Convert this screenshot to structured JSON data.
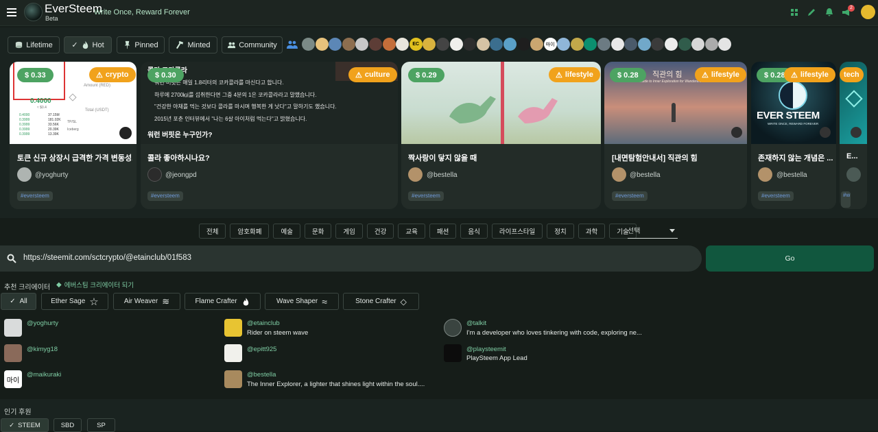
{
  "header": {
    "brand": "EverSteem",
    "tagline": "Write Once, Reward Forever",
    "beta": "Beta",
    "notifications": "2"
  },
  "tabs": [
    {
      "label": "Lifetime",
      "icon": "coins-icon"
    },
    {
      "label": "Hot",
      "icon": "fire-icon",
      "active": true
    },
    {
      "label": "Pinned",
      "icon": "pin-icon"
    },
    {
      "label": "Minted",
      "icon": "hammer-icon"
    },
    {
      "label": "Community",
      "icon": "group-icon"
    }
  ],
  "avatar_labels": [
    "EC",
    "마이"
  ],
  "cards": [
    {
      "price": "$ 0.33",
      "category": "crypto",
      "title": "토큰 신규 상장시 급격한 가격 변동성...",
      "user": "@yoghurty",
      "tag": "#eversteem"
    },
    {
      "price": "$ 0.30",
      "category": "culture",
      "title": "콜라 좋아하시나요?",
      "user": "@jeongpd",
      "tag": "#eversteem"
    },
    {
      "price": "$ 0.29",
      "category": "lifestyle",
      "title": "짝사랑이 닿지 않을 때",
      "user": "@bestella",
      "tag": "#eversteem"
    },
    {
      "price": "$ 0.28",
      "category": "lifestyle",
      "title": "[내면탐험안내서] 직관의 힘",
      "user": "@bestella",
      "tag": "#eversteem"
    },
    {
      "price": "$ 0.28",
      "category": "lifestyle",
      "title": "존재하지 않는 개념은 ...",
      "user": "@bestella",
      "tag": "#eversteem"
    },
    {
      "price": "",
      "category": "tech",
      "title": "E...",
      "user": "",
      "tag": "#w"
    }
  ],
  "thumb_text": {
    "crypto_amount": "0.4000",
    "crypto_sub": "≈ $0.4",
    "crypto_label_red": "Amount (RED)",
    "crypto_total": "Total (USDT)",
    "crypto_tpsl": "TP/SL",
    "crypto_iceberg": "Iceberg",
    "crypto_prices": [
      "0.4000",
      "0.3999",
      "0.3999",
      "0.3999",
      "0.3999"
    ],
    "crypto_vols": [
      "37.15M",
      "181.02K",
      "33.56K",
      "20.39K",
      "13.39K"
    ],
    "culture_heading": "콜라 코카콜라",
    "culture_lines": [
      "워런 버핏은 매일 1.8리터의 코카콜라를 마신다고 합니다.",
      "하루에 2700㎉를 섭취한다면 그중 4분의 1은 코카콜라라고 말했습니다.",
      "\"건강한 야채를 먹는 것보다 콜라를 마시며 행복한 게 낫다\"고 말하기도 했습니다.",
      "2015년 포춘 인터뷰에서 \"나는 6살 아이처럼 먹는다\"고 밝혔습니다."
    ],
    "culture_q": "워런 버핏은 누구인가?",
    "intuition_title": "직관의 힘",
    "intuition_sub": "A Guide to Inner Exploration for Wanderers",
    "ever_title": "EVER STEEM",
    "ever_sub": "WRITE ONCE, REWARD FOREVER"
  },
  "categories": [
    "전체",
    "암호화폐",
    "예술",
    "문화",
    "게임",
    "건강",
    "교육",
    "패션",
    "음식",
    "라이프스타일",
    "정치",
    "과학",
    "기술"
  ],
  "select_value": "선택",
  "url": "https://steemit.com/sctcrypto/@etainclub/01f583",
  "go_label": "Go",
  "creators": {
    "label": "추천 크리에이터",
    "become": "에버스팀 크리에이터 되기",
    "filters": [
      "All",
      "Ether Sage",
      "Air Weaver",
      "Flame Crafter",
      "Wave Shaper",
      "Stone Crafter"
    ],
    "list": [
      {
        "name": "@yoghurty",
        "desc": ""
      },
      {
        "name": "@etainclub",
        "desc": "Rider  on steem wave"
      },
      {
        "name": "@talkit",
        "desc": "I'm a developer who loves tinkering with code, exploring ne..."
      },
      {
        "name": "@kimyg18",
        "desc": ""
      },
      {
        "name": "@epitt925",
        "desc": ""
      },
      {
        "name": "@playsteemit",
        "desc": "PlaySteem App Lead"
      },
      {
        "name": "@maikuraki",
        "desc": "",
        "avatar_text": "마이"
      },
      {
        "name": "@bestella",
        "desc": "The Inner Explorer, a lighter that shines light within the soul...."
      }
    ]
  },
  "popular": {
    "label": "인기 후원",
    "tabs": [
      "STEEM",
      "SBD",
      "SP"
    ]
  },
  "colors": {
    "accent": "#4da362",
    "category": "#f1a21c",
    "go": "#11573e",
    "link": "#7fcda4"
  }
}
